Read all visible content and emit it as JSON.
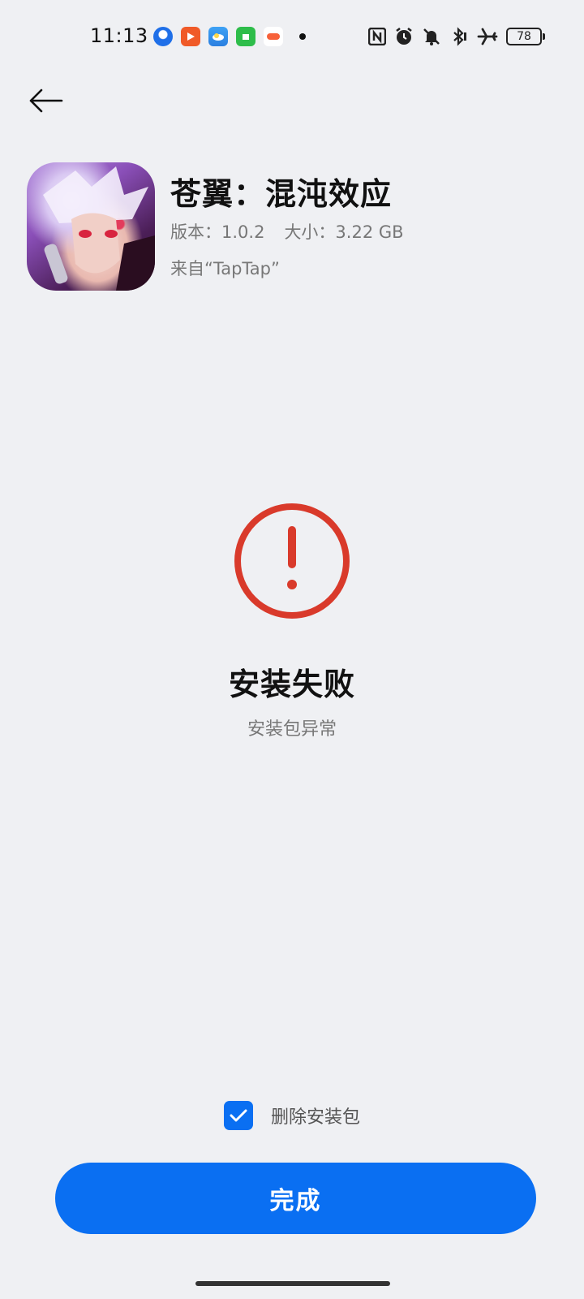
{
  "status_bar": {
    "time": "11:13",
    "notification_icons": [
      "assistant-app-icon",
      "video-app-icon",
      "weather-app-icon",
      "store-app-icon",
      "game-app-icon"
    ],
    "system_icons": [
      "nfc-icon",
      "alarm-icon",
      "silent-icon",
      "bluetooth-icon",
      "airplane-icon"
    ],
    "battery": "78"
  },
  "app": {
    "name": "苍翼：混沌效应",
    "version": "版本：1.0.2",
    "size": "大小：3.22 GB",
    "source": "来自“TapTap”"
  },
  "result": {
    "title": "安装失败",
    "subtitle": "安装包异常",
    "accent": "#d93a2b"
  },
  "options": {
    "delete_label": "删除安装包",
    "delete_checked": true
  },
  "actions": {
    "done_label": "完成",
    "button_color": "#0a6ff2"
  }
}
